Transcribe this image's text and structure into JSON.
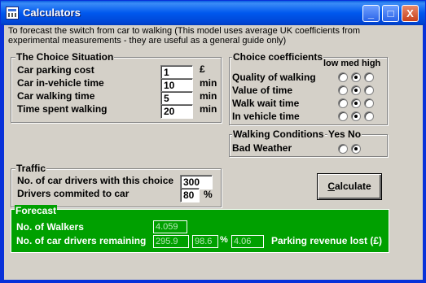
{
  "window": {
    "title": "Calculators",
    "buttons": [
      "_",
      "□",
      "X"
    ]
  },
  "intro": {
    "line1": "To forecast the switch from car to walking  (This model uses average UK coefficients from",
    "line2": "experimental measurements - they are useful as a general guide only)"
  },
  "choice_situation": {
    "legend": "The Choice Situation",
    "rows": [
      {
        "label": "Car parking cost",
        "value": "1",
        "unit": "£"
      },
      {
        "label": "Car in-vehicle time",
        "value": "10",
        "unit": "min"
      },
      {
        "label": "Car walking time",
        "value": "5",
        "unit": "min"
      },
      {
        "label": "Time spent walking",
        "value": "20",
        "unit": "min"
      }
    ]
  },
  "coefficients": {
    "legend": "Choice coefficients",
    "header": "low med high",
    "rows": [
      {
        "label": "Quality of walking",
        "selected": "med"
      },
      {
        "label": "Value of time",
        "selected": "med"
      },
      {
        "label": "Walk wait time",
        "selected": "med"
      },
      {
        "label": "In vehicle time",
        "selected": "med"
      }
    ]
  },
  "walking_conditions": {
    "legend": "Walking Conditions",
    "header": "Yes No",
    "row_label": "Bad Weather",
    "selected": "No"
  },
  "traffic": {
    "legend": "Traffic",
    "drivers_label": "No. of car drivers with this choice",
    "drivers_value": "300",
    "committed_label": "Drivers commited to car",
    "committed_value": "80",
    "committed_unit": "%"
  },
  "calculate": {
    "label": "Calculate"
  },
  "forecast": {
    "legend": "Forecast",
    "walkers_label": "No. of Walkers",
    "walkers_value": "4.059",
    "remaining_label": "No. of car drivers remaining",
    "remaining_value": "295.9",
    "remaining_pct": "98.6",
    "pct_sign": "%",
    "revenue_value": "4.06",
    "revenue_label": "Parking revenue lost (£)"
  },
  "colors": {
    "titlebar": "#0058ee",
    "client": "#d4d0c8",
    "forecast_bg": "#00a000"
  }
}
